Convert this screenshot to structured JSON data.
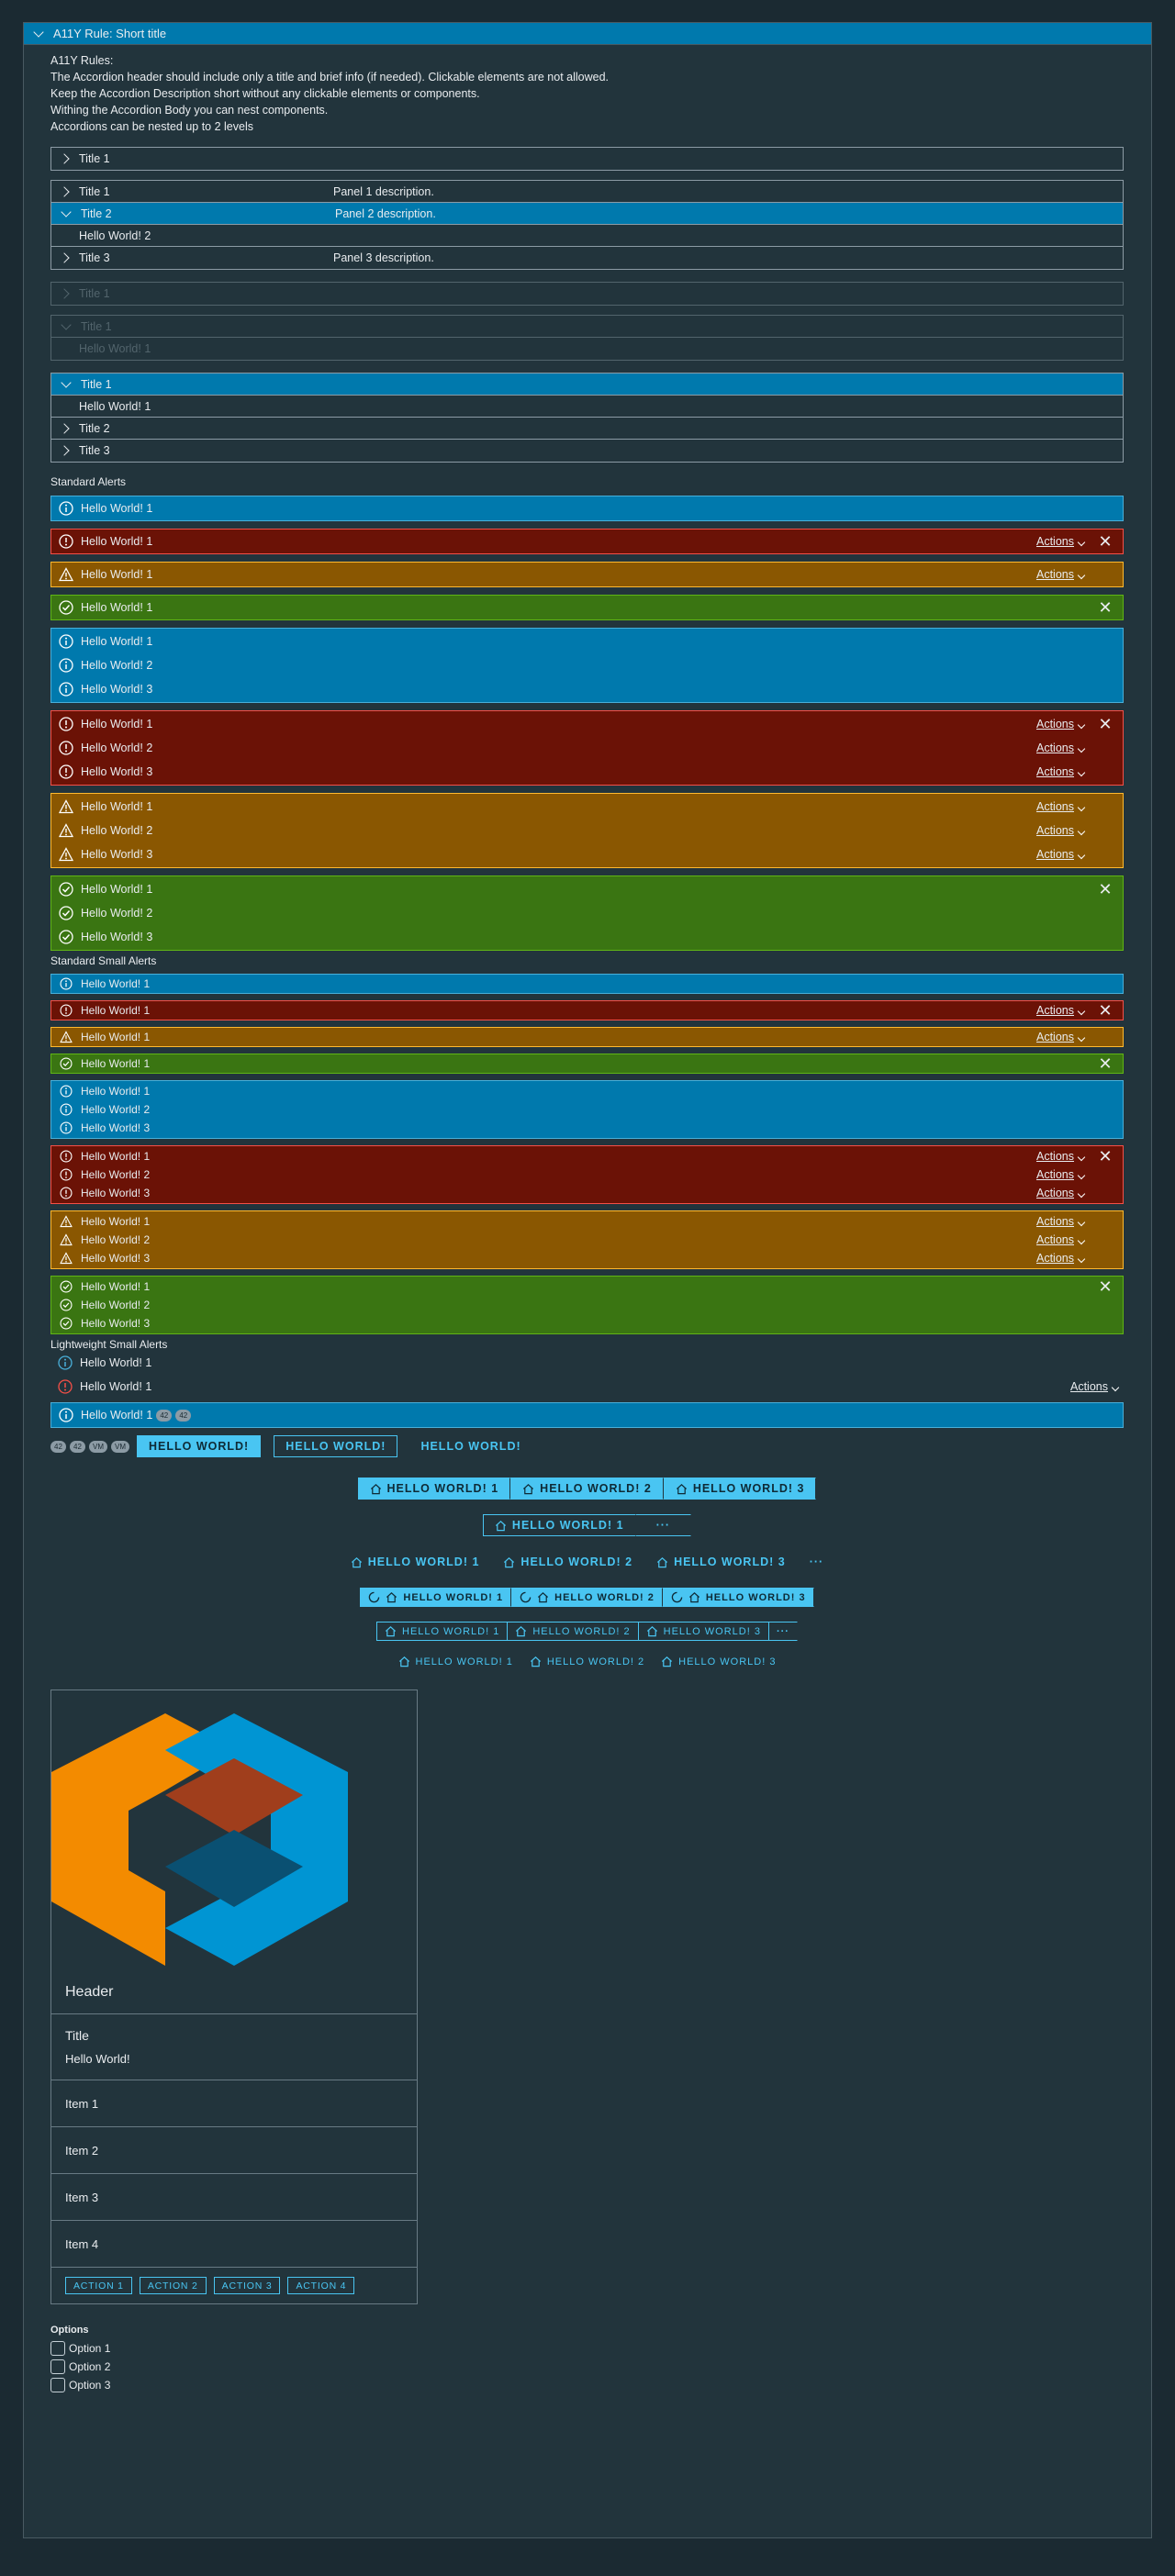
{
  "accordion": {
    "title": "A11Y Rule: Short title",
    "rules": [
      "A11Y Rules:",
      "The Accordion header should include only a title and brief info (if needed). Clickable elements are not allowed.",
      "Keep the Accordion Description short without any clickable elements or components.",
      "Withing the Accordion Body you can nest components.",
      "Accordions can be nested up to 2 levels"
    ],
    "single_title": "Title 1",
    "multi": [
      {
        "title": "Title 1",
        "desc": "Panel 1 description."
      },
      {
        "title": "Title 2",
        "desc": "Panel 2 description.",
        "body": "Hello World! 2"
      },
      {
        "title": "Title 3",
        "desc": "Panel 3 description."
      }
    ],
    "disabled_title": "Title 1",
    "disabled_open_title": "Title 1",
    "disabled_open_body": "Hello World! 1",
    "stack": [
      {
        "title": "Title 1",
        "body": "Hello World! 1"
      },
      {
        "title": "Title 2"
      },
      {
        "title": "Title 3"
      }
    ]
  },
  "alerts": {
    "standard_label": "Standard Alerts",
    "small_label": "Standard Small Alerts",
    "light_label": "Lightweight Small Alerts",
    "msg1": "Hello World! 1",
    "msg2": "Hello World! 2",
    "msg3": "Hello World! 3",
    "actions": "Actions",
    "badge": "42",
    "badge_vm": "VM"
  },
  "buttons": {
    "hello": "HELLO WORLD!",
    "hello1": "HELLO WORLD! 1",
    "hello2": "HELLO WORLD! 2",
    "hello3": "HELLO WORLD! 3",
    "more": "···"
  },
  "card": {
    "header": "Header",
    "title": "Title",
    "text": "Hello World!",
    "items": [
      "Item 1",
      "Item 2",
      "Item 3",
      "Item 4"
    ],
    "actions": [
      "ACTION 1",
      "ACTION 2",
      "ACTION 3",
      "ACTION 4"
    ]
  },
  "options": {
    "label": "Options",
    "items": [
      "Option 1",
      "Option 2",
      "Option 3"
    ]
  },
  "colors": {
    "info": "#0079ad",
    "danger": "#6b1206",
    "warning": "#8a5701",
    "success": "#3a7512",
    "accent": "#49c5f2"
  }
}
